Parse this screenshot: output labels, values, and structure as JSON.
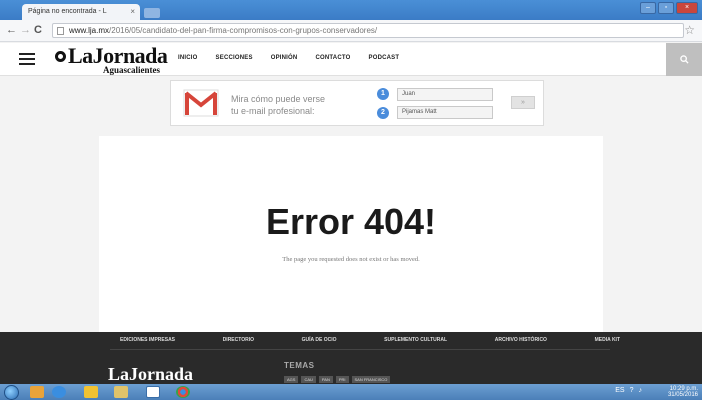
{
  "browser": {
    "tab_title": "Página no encontrada - L",
    "tab_close": "×",
    "url_domain": "www.lja.mx",
    "url_path": "/2016/05/candidato-del-pan-firma-compromisos-con-grupos-conservadores/",
    "back": "←",
    "forward": "→",
    "reload": "C",
    "star": "☆"
  },
  "header": {
    "logo_main": "LaJornada",
    "logo_sub": "Aguascalientes",
    "nav": [
      "INICIO",
      "SECCIONES",
      "OPINIÓN",
      "CONTACTO",
      "PODCAST"
    ],
    "search_icon": "search-icon"
  },
  "ad": {
    "line1": "Mira cómo puede verse",
    "line2": "tu e-mail profesional:",
    "step1": "1",
    "step2": "2",
    "field1": "Juan",
    "field2": "Pijamas Matt",
    "go": "»"
  },
  "error": {
    "title": "Error 404!",
    "message": "The page you requested does not exist or has moved."
  },
  "footer": {
    "nav": [
      "EDICIONES IMPRESAS",
      "DIRECTORIO",
      "GUÍA DE OCIO",
      "SUPLEMENTO CULTURAL",
      "ARCHIVO HISTÓRICO",
      "MEDIA KIT"
    ],
    "logo": "LaJornada",
    "temas": "TEMAS",
    "tags": [
      "AGS",
      "CAU",
      "PAN",
      "PRI",
      "SAN FRANCISCO"
    ]
  },
  "taskbar": {
    "time": "10:29 p.m.",
    "date": "31/05/2016",
    "lang": "ES"
  }
}
